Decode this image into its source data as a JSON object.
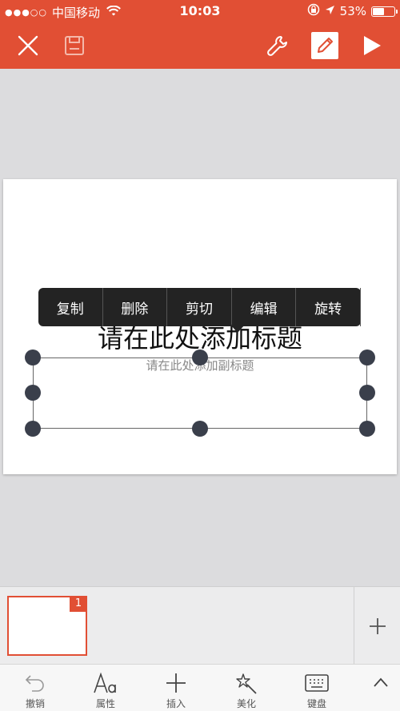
{
  "status_bar": {
    "signal_dots": "●●●○○",
    "carrier": "中国移动",
    "time": "10:03",
    "battery_percent": "53%",
    "battery_level": 0.53
  },
  "toolbar": {
    "close_icon": "close-icon",
    "save_icon": "save-icon",
    "tools_icon": "wrench-icon",
    "edit_icon": "pen-icon",
    "play_icon": "play-icon"
  },
  "slide": {
    "title": "请在此处添加标题",
    "subtitle": "请在此处添加副标题"
  },
  "context_menu": {
    "items": [
      "复制",
      "删除",
      "剪切",
      "编辑",
      "旋转"
    ]
  },
  "thumbnails": {
    "slide_number": "1"
  },
  "bottom_bar": {
    "items": [
      "撤销",
      "属性",
      "插入",
      "美化",
      "键盘"
    ]
  },
  "colors": {
    "accent": "#e14f34",
    "handle": "#3a3f4b",
    "menu_bg": "#232323"
  }
}
